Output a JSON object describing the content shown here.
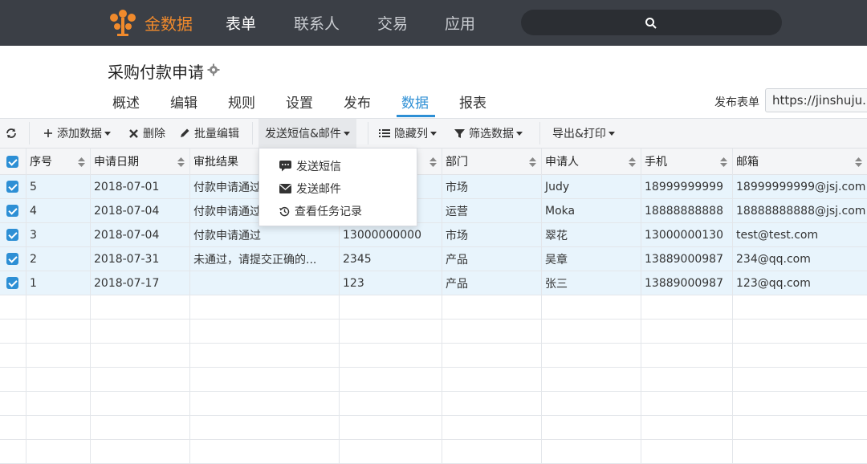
{
  "nav": {
    "brand": "金数据",
    "items": [
      "表单",
      "联系人",
      "交易",
      "应用"
    ],
    "active_index": 0,
    "accent": "#f08a2c"
  },
  "form": {
    "title": "采购付款申请",
    "tabs": [
      "概述",
      "编辑",
      "规则",
      "设置",
      "发布",
      "数据",
      "报表"
    ],
    "active_tab": "数据",
    "publish_label": "发布表单",
    "publish_url": "https://jinshuju.n"
  },
  "toolbar": {
    "add": "添加数据",
    "delete": "删除",
    "batch_edit": "批量编辑",
    "send": "发送短信&邮件",
    "hide_cols": "隐藏列",
    "filter": "筛选数据",
    "export": "导出&打印"
  },
  "dropdown": {
    "items": [
      {
        "label": "发送短信",
        "icon": "message-icon"
      },
      {
        "label": "发送邮件",
        "icon": "envelope-icon"
      },
      {
        "label": "查看任务记录",
        "icon": "history-icon"
      }
    ]
  },
  "table": {
    "headers": [
      "序号",
      "申请日期",
      "审批结果",
      "",
      "部门",
      "申请人",
      "手机",
      "邮箱"
    ],
    "rows": [
      [
        "5",
        "2018-07-01",
        "付款申请通过",
        "",
        "市场",
        "Judy",
        "18999999999",
        "18999999999@jsj.com"
      ],
      [
        "4",
        "2018-07-04",
        "付款申请通过",
        "",
        "运营",
        "Moka",
        "18888888888",
        "18888888888@jsj.com"
      ],
      [
        "3",
        "2018-07-04",
        "付款申请通过",
        "13000000000",
        "市场",
        "翠花",
        "13000000130",
        "test@test.com"
      ],
      [
        "2",
        "2018-07-31",
        "未通过，请提交正确的...",
        "2345",
        "产品",
        "吴章",
        "13889000987",
        "234@qq.com"
      ],
      [
        "1",
        "2018-07-17",
        "",
        "123",
        "产品",
        "张三",
        "13889000987",
        "123@qq.com"
      ]
    ]
  },
  "colors": {
    "accent_blue": "#2d8fd5",
    "nav_bg": "#3b3f46",
    "row_selected": "#e8f4fc"
  }
}
